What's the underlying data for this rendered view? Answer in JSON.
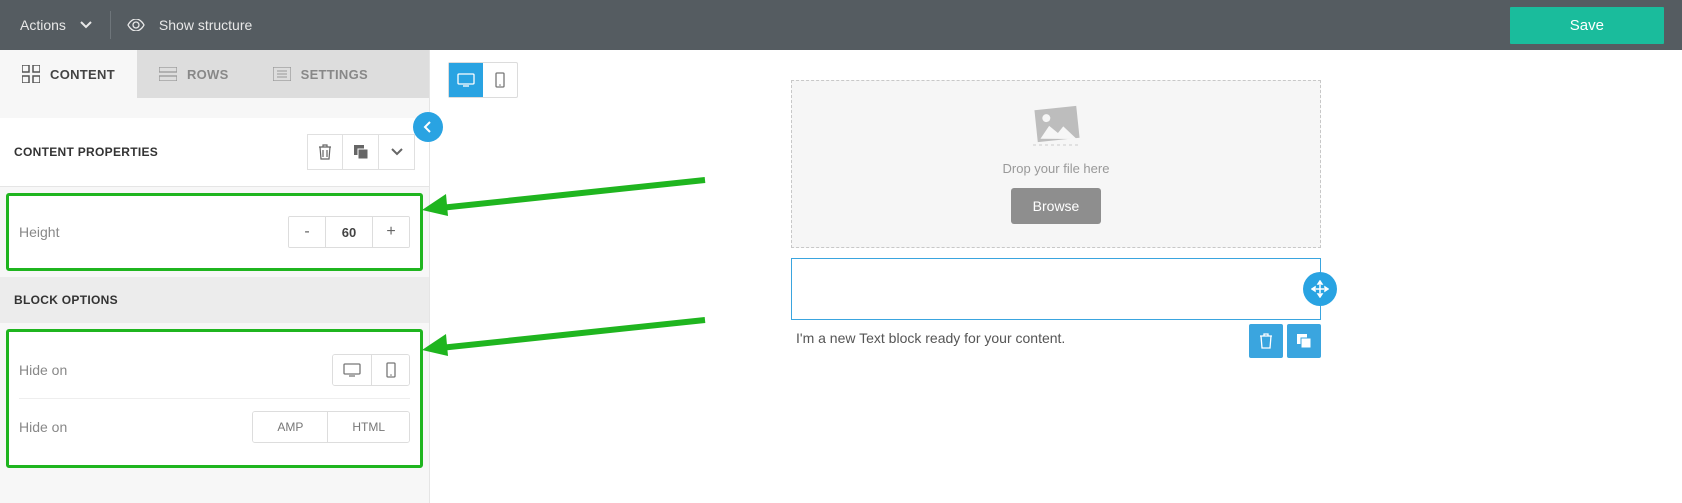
{
  "topbar": {
    "actions": "Actions",
    "show_structure": "Show structure",
    "save": "Save"
  },
  "tabs": {
    "content": "CONTENT",
    "rows": "ROWS",
    "settings": "SETTINGS"
  },
  "sections": {
    "content_properties": "CONTENT PROPERTIES",
    "block_options": "BLOCK OPTIONS"
  },
  "props": {
    "height_label": "Height",
    "height_value": "60",
    "hide_on_label": "Hide on",
    "amp": "AMP",
    "html": "HTML"
  },
  "canvas": {
    "drop_hint": "Drop your file here",
    "browse": "Browse",
    "text_block": "I'm a new Text block ready for your content."
  },
  "colors": {
    "accent": "#29a3e2",
    "highlight": "#1fb51f",
    "save": "#1abc9c"
  }
}
